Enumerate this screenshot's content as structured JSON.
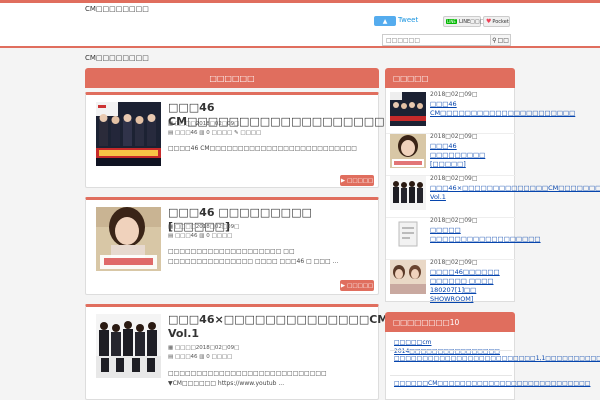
{
  "colors": {
    "accent": "#e06e5e",
    "link": "#0645ad",
    "twitter": "#55acee",
    "line": "#00b900",
    "pocket": "#ef4056"
  },
  "header": {
    "site_title": "CM□□□□□□□□",
    "tweet_label": "Tweet",
    "line_label": "LINE□□□",
    "line_badge": "LINE",
    "pocket_label": "Pocket",
    "search_placeholder": "□□□□□□",
    "search_button": "□□"
  },
  "breadcrumb": "CM□□□□□□□□",
  "main": {
    "heading": "□□□□□□",
    "read_more": "□□□□□",
    "posts": [
      {
        "title": "□□□46 CM□□□□□□□□□□□□□□□□□□□□□□□□□□",
        "date": "□□□□2018□02□09□",
        "category": "□□□46",
        "comments": "0",
        "comments_label": "□□□□",
        "tag": "□□□□",
        "excerpt": "□□□□46 CM□□□□□□□□□□□□□□□□□□□□□□□□□□"
      },
      {
        "title": "□□□46 □□□□□□□□□ [□□□□□]",
        "date": "□□□□2018□02□09□",
        "category": "□□□46",
        "comments": "0",
        "comments_label": "□□□□",
        "excerpt": "□□□□□□□□□□□□□□□□□□□□ □□ □□□□□□□□□□□□□□□ □□□□ □□□46 □ □□□ ..."
      },
      {
        "title": "□□□46×□□□□□□□□□□□□□□CM□□□□□□□□□ Vol.1",
        "date": "□□□□2018□02□09□",
        "category": "□□□46",
        "comments": "0",
        "comments_label": "□□□□",
        "excerpt": "□□□□□□□□□□□□□□□□□□□□□□□□□□□□ ▼CM□□□□□□ https://www.youtub ..."
      }
    ]
  },
  "sidebar": {
    "recent_heading": "□□□□□",
    "recent": [
      {
        "date": "2018□02□09□",
        "title": "□□□46 CM□□□□□□□□□□□□□□□□□□□□□□"
      },
      {
        "date": "2018□02□09□",
        "title": "□□□46 □□□□□□□□□ [□□□□□]"
      },
      {
        "date": "2018□02□09□",
        "title": "□□□46×□□□□□□□□□□□□□□CM□□□□□□□□□ Vol.1"
      },
      {
        "date": "2018□02□09□",
        "title": "□□□□□ □□□□□□□□□□□□□□□□□□"
      },
      {
        "date": "2018□02□09□",
        "title": "□□□□46□□□□□□ □□□□□□ □□□□ 180207[1]□□ SHOWROOM]"
      }
    ],
    "ranking_heading": "□□□□□□□□10",
    "ranking": [
      "□□□□□cm 2014□□□□□□□□□□□□□□□□",
      "□□□□□□□□□□□□□□□□□□□□□□□□□1,1□□□□□□□□□□",
      "□□□□□□CM□□□□□□□□□□□□□□□□□□□□□□□□□□□"
    ]
  }
}
